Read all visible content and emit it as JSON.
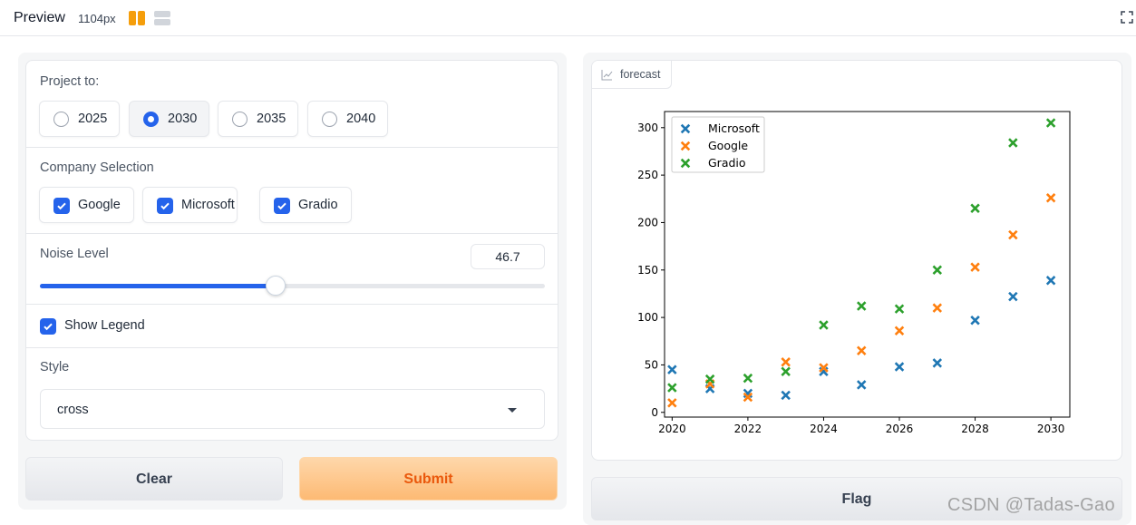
{
  "header": {
    "title": "Preview",
    "width_label": "1104px"
  },
  "form": {
    "project_to": {
      "label": "Project to:",
      "options": [
        "2025",
        "2030",
        "2035",
        "2040"
      ],
      "selected": "2030"
    },
    "company": {
      "label": "Company Selection",
      "options": [
        "Google",
        "Microsoft",
        "Gradio"
      ],
      "checked": [
        "Google",
        "Microsoft",
        "Gradio"
      ]
    },
    "noise": {
      "label": "Noise Level",
      "value": "46.7",
      "fraction": 0.467
    },
    "legend": {
      "label": "Show Legend",
      "checked": true
    },
    "style": {
      "label": "Style",
      "value": "cross"
    }
  },
  "buttons": {
    "clear": "Clear",
    "submit": "Submit",
    "flag": "Flag"
  },
  "plot": {
    "label": "forecast"
  },
  "colors": {
    "accent": "#2563eb",
    "microsoft": "#1f77b4",
    "google": "#ff7f0e",
    "gradio": "#2ca02c",
    "submit_text": "#ea580c"
  },
  "chart_data": {
    "type": "scatter",
    "marker": "x",
    "x": [
      2020,
      2021,
      2022,
      2023,
      2024,
      2025,
      2026,
      2027,
      2028,
      2029,
      2030
    ],
    "series": [
      {
        "name": "Microsoft",
        "values": [
          45,
          25,
          20,
          18,
          43,
          29,
          48,
          52,
          97,
          122,
          139
        ]
      },
      {
        "name": "Google",
        "values": [
          10,
          30,
          16,
          53,
          47,
          65,
          86,
          110,
          153,
          187,
          226
        ]
      },
      {
        "name": "Gradio",
        "values": [
          26,
          35,
          36,
          43,
          92,
          112,
          109,
          150,
          215,
          284,
          305
        ]
      }
    ],
    "xlim": [
      2019.8,
      2030.5
    ],
    "ylim": [
      -5,
      317
    ],
    "xticks": [
      2020,
      2022,
      2024,
      2026,
      2028,
      2030
    ],
    "yticks": [
      0,
      50,
      100,
      150,
      200,
      250,
      300
    ],
    "legend": "top-left",
    "grid": false
  },
  "watermark": "CSDN @Tadas-Gao"
}
